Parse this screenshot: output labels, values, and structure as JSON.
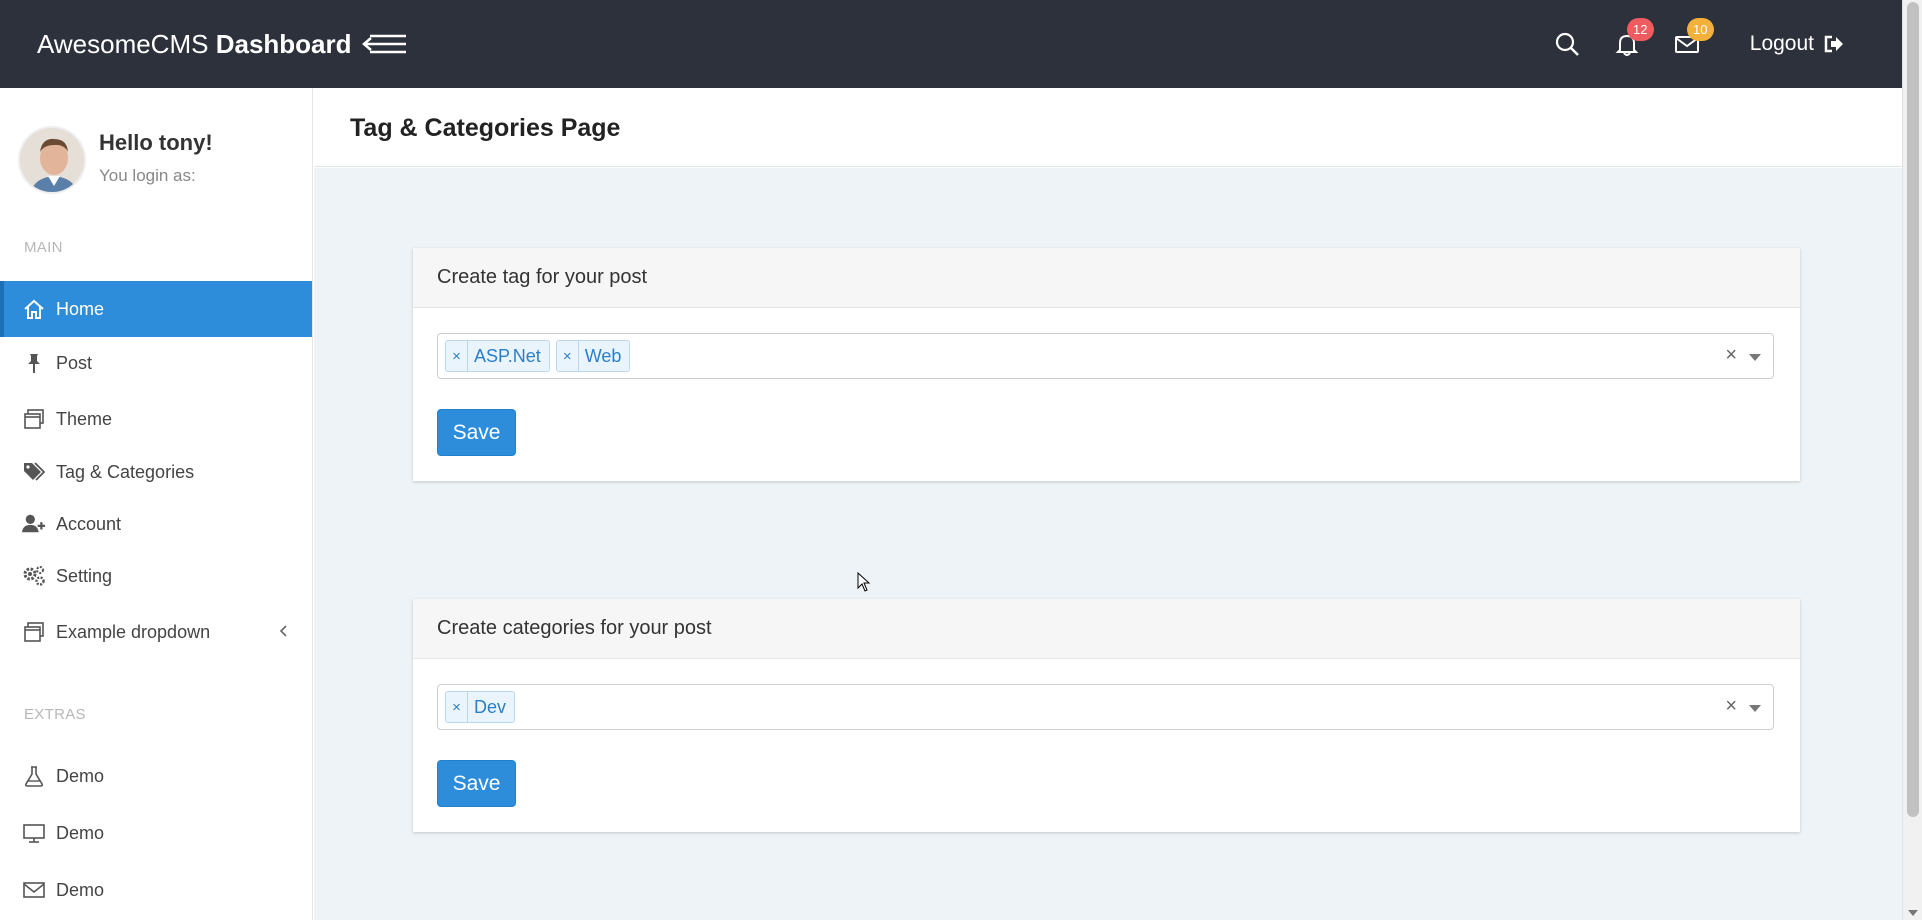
{
  "header": {
    "brand_light": "AwesomeCMS",
    "brand_bold": "Dashboard",
    "notifications_count": "12",
    "messages_count": "10",
    "logout_label": "Logout"
  },
  "sidebar": {
    "hello": "Hello tony!",
    "login_as": "You login as:",
    "main_label": "MAIN",
    "extras_label": "EXTRAS",
    "items": [
      {
        "label": "Home",
        "icon": "home-icon"
      },
      {
        "label": "Post",
        "icon": "pin-icon"
      },
      {
        "label": "Theme",
        "icon": "window-icon"
      },
      {
        "label": "Tag & Categories",
        "icon": "tags-icon"
      },
      {
        "label": "Account",
        "icon": "user-plus-icon"
      },
      {
        "label": "Setting",
        "icon": "gears-icon"
      },
      {
        "label": "Example dropdown",
        "icon": "window-icon"
      }
    ],
    "extras": [
      {
        "label": "Demo",
        "icon": "flask-icon"
      },
      {
        "label": "Demo",
        "icon": "monitor-icon"
      },
      {
        "label": "Demo",
        "icon": "envelope-icon"
      }
    ]
  },
  "page": {
    "title": "Tag & Categories Page"
  },
  "tag_card": {
    "title": "Create tag for your post",
    "tags": [
      "ASP.Net",
      "Web"
    ],
    "save_label": "Save"
  },
  "category_card": {
    "title": "Create categories for your post",
    "tags": [
      "Dev"
    ],
    "save_label": "Save"
  },
  "colors": {
    "topbar": "#2c313c",
    "accent": "#2e8ddb",
    "badge_red": "#f05b5f",
    "badge_yellow": "#f4b13a"
  }
}
